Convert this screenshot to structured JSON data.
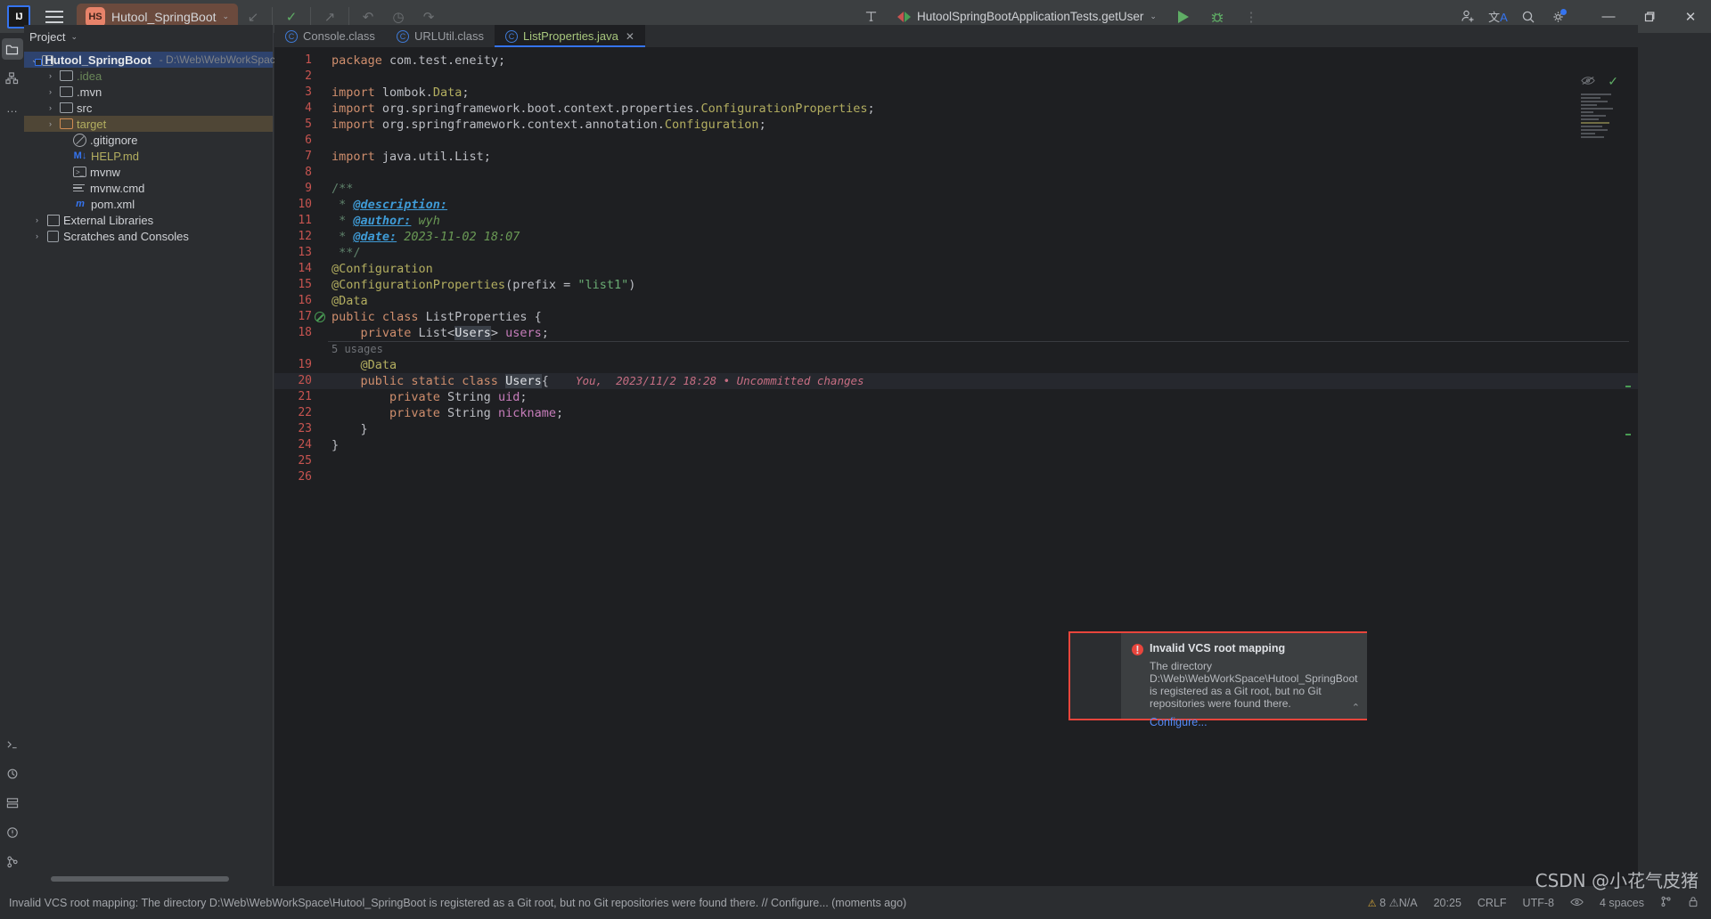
{
  "titlebar": {
    "ij_logo": "IJ",
    "menu_icon": "hamburger-menu-icon",
    "project_badge": "HS",
    "project_name": "Hutool_SpringBoot",
    "chevron": "⌄",
    "buttons": [
      {
        "name": "update-project-button",
        "glyph": "↙",
        "style": "dim"
      },
      {
        "name": "commit-button",
        "glyph": "✓",
        "style": "green"
      },
      {
        "name": "push-button",
        "glyph": "↗",
        "style": "dim"
      },
      {
        "name": "undo-button",
        "glyph": "↶",
        "style": "dim"
      },
      {
        "name": "history-button",
        "glyph": "◷",
        "style": "dim"
      },
      {
        "name": "redo-button",
        "glyph": "↷",
        "style": "dim"
      }
    ],
    "build_icon": "hammer-icon",
    "run_config": "HutoolSpringBootApplicationTests.getUser",
    "run_button": "run-icon",
    "debug_button": "debug-icon",
    "more_button": "⋮",
    "right_icons": [
      {
        "name": "add-user-icon",
        "glyph": "⚇"
      },
      {
        "name": "translate-icon",
        "glyph": "文"
      },
      {
        "name": "search-icon",
        "glyph": "⌕"
      },
      {
        "name": "settings-gear-icon",
        "glyph": "⚙"
      }
    ],
    "window_controls": {
      "minimize": "—",
      "maximize": "❐",
      "close": "✕"
    }
  },
  "rail": {
    "top": [
      {
        "name": "project-tool-icon",
        "glyph": "▢",
        "active": true
      },
      {
        "name": "structure-tool-icon",
        "glyph": "⛓"
      },
      {
        "name": "more-tool-icon",
        "glyph": "…"
      }
    ],
    "bottom": [
      {
        "name": "terminal-tool-icon",
        "glyph": "⎇"
      },
      {
        "name": "build-tool-icon",
        "glyph": "⚒"
      },
      {
        "name": "services-tool-icon",
        "glyph": "⊙"
      },
      {
        "name": "problems-tool-icon",
        "glyph": "ⓘ"
      },
      {
        "name": "version-control-tool-icon",
        "glyph": "⎇"
      }
    ]
  },
  "project": {
    "title": "Project",
    "chevron": "⌄",
    "tree": [
      {
        "indent": 0,
        "arrow": "⌄",
        "icon": "module-icon",
        "label": "Hutool_SpringBoot",
        "bold": true,
        "path": "- D:\\Web\\WebWorkSpace\\H",
        "selected": "blue"
      },
      {
        "indent": 1,
        "arrow": "›",
        "icon": "folder-icon",
        "label": ".idea",
        "color": "green"
      },
      {
        "indent": 1,
        "arrow": "›",
        "icon": "folder-icon",
        "label": ".mvn"
      },
      {
        "indent": 1,
        "arrow": "›",
        "icon": "folder-icon",
        "label": "src"
      },
      {
        "indent": 1,
        "arrow": "›",
        "icon": "folder-orange-icon",
        "label": "target",
        "color": "yellow",
        "selected": "brown"
      },
      {
        "indent": 2,
        "arrow": "",
        "icon": "gitignore-icon",
        "label": ".gitignore"
      },
      {
        "indent": 2,
        "arrow": "",
        "icon": "markdown-icon",
        "label": "HELP.md",
        "color": "yellow"
      },
      {
        "indent": 2,
        "arrow": "",
        "icon": "shell-script-icon",
        "label": "mvnw"
      },
      {
        "indent": 2,
        "arrow": "",
        "icon": "cmd-file-icon",
        "label": "mvnw.cmd"
      },
      {
        "indent": 2,
        "arrow": "",
        "icon": "maven-pom-icon",
        "label": "pom.xml"
      },
      {
        "indent": 0,
        "arrow": "›",
        "icon": "external-libraries-icon",
        "label": "External Libraries"
      },
      {
        "indent": 0,
        "arrow": "›",
        "icon": "scratches-icon",
        "label": "Scratches and Consoles"
      }
    ]
  },
  "editor": {
    "tabs": [
      {
        "label": "Console.class",
        "icon": "class-file-icon",
        "active": false,
        "closable": false
      },
      {
        "label": "URLUtil.class",
        "icon": "class-file-icon",
        "active": false,
        "closable": false
      },
      {
        "label": "ListProperties.java",
        "icon": "java-class-icon",
        "active": true,
        "closable": true,
        "close_glyph": "✕"
      }
    ],
    "inline_hints": {
      "usages": "5 usages",
      "vcs_annotation": "You,  2023/11/2 18:28 • Uncommitted changes"
    },
    "inspection": {
      "eye_icon": "preview-eye-icon",
      "ok_icon": "✓"
    },
    "lines": [
      {
        "n": "1",
        "tokens": [
          {
            "t": "package ",
            "c": "kw"
          },
          {
            "t": "com.test.eneity;",
            "c": "plain"
          }
        ]
      },
      {
        "n": "2",
        "tokens": []
      },
      {
        "n": "3",
        "tokens": [
          {
            "t": "import ",
            "c": "kw"
          },
          {
            "t": "lombok.",
            "c": "plain"
          },
          {
            "t": "Data",
            "c": "ann"
          },
          {
            "t": ";",
            "c": "plain"
          }
        ]
      },
      {
        "n": "4",
        "tokens": [
          {
            "t": "import ",
            "c": "kw"
          },
          {
            "t": "org.springframework.boot.context.properties.",
            "c": "plain"
          },
          {
            "t": "ConfigurationProperties",
            "c": "ann"
          },
          {
            "t": ";",
            "c": "plain"
          }
        ]
      },
      {
        "n": "5",
        "tokens": [
          {
            "t": "import ",
            "c": "kw"
          },
          {
            "t": "org.springframework.context.annotation.",
            "c": "plain"
          },
          {
            "t": "Configuration",
            "c": "ann"
          },
          {
            "t": ";",
            "c": "plain"
          }
        ]
      },
      {
        "n": "6",
        "tokens": []
      },
      {
        "n": "7",
        "tokens": [
          {
            "t": "import ",
            "c": "kw"
          },
          {
            "t": "java.util.List;",
            "c": "plain"
          }
        ]
      },
      {
        "n": "8",
        "tokens": []
      },
      {
        "n": "9",
        "tokens": [
          {
            "t": "/**",
            "c": "doc"
          }
        ]
      },
      {
        "n": "10",
        "tokens": [
          {
            "t": " * ",
            "c": "doc"
          },
          {
            "t": "@description:",
            "c": "doctag"
          }
        ]
      },
      {
        "n": "11",
        "tokens": [
          {
            "t": " * ",
            "c": "doc"
          },
          {
            "t": "@author:",
            "c": "doctag"
          },
          {
            "t": " wyh",
            "c": "docval"
          }
        ]
      },
      {
        "n": "12",
        "tokens": [
          {
            "t": " * ",
            "c": "doc"
          },
          {
            "t": "@date:",
            "c": "doctag"
          },
          {
            "t": " 2023-11-02 18:07",
            "c": "docval"
          }
        ]
      },
      {
        "n": "13",
        "tokens": [
          {
            "t": " **/",
            "c": "doc"
          }
        ]
      },
      {
        "n": "14",
        "tokens": [
          {
            "t": "@Configuration",
            "c": "ann"
          }
        ]
      },
      {
        "n": "15",
        "tokens": [
          {
            "t": "@ConfigurationProperties",
            "c": "ann"
          },
          {
            "t": "(prefix = ",
            "c": "plain"
          },
          {
            "t": "\"list1\"",
            "c": "str"
          },
          {
            "t": ")",
            "c": "plain"
          }
        ]
      },
      {
        "n": "16",
        "tokens": [
          {
            "t": "@Data",
            "c": "ann"
          }
        ]
      },
      {
        "n": "17",
        "gutter": "suppress-inspection-icon",
        "tokens": [
          {
            "t": "public class ",
            "c": "kw"
          },
          {
            "t": "ListProperties",
            "c": "plain"
          },
          {
            "t": " {",
            "c": "plain"
          }
        ]
      },
      {
        "n": "18",
        "tokens": [
          {
            "t": "    private ",
            "c": "kw"
          },
          {
            "t": "List<",
            "c": "plain"
          },
          {
            "t": "Users",
            "c": "hl"
          },
          {
            "t": "> ",
            "c": "plain"
          },
          {
            "t": "users",
            "c": "field"
          },
          {
            "t": ";",
            "c": "plain"
          }
        ]
      },
      {
        "n": "",
        "hint": "5 usages",
        "separator": true,
        "tokens": []
      },
      {
        "n": "19",
        "tokens": [
          {
            "t": "    @Data",
            "c": "ann"
          }
        ]
      },
      {
        "n": "20",
        "current": true,
        "annotation": "You,  2023/11/2 18:28 • Uncommitted changes",
        "tokens": [
          {
            "t": "    public static class ",
            "c": "kw"
          },
          {
            "t": "Users",
            "c": "hl"
          },
          {
            "t": "{",
            "c": "plain"
          }
        ]
      },
      {
        "n": "21",
        "tokens": [
          {
            "t": "        private ",
            "c": "kw"
          },
          {
            "t": "String ",
            "c": "plain"
          },
          {
            "t": "uid",
            "c": "field"
          },
          {
            "t": ";",
            "c": "plain"
          }
        ]
      },
      {
        "n": "22",
        "tokens": [
          {
            "t": "        private ",
            "c": "kw"
          },
          {
            "t": "String ",
            "c": "plain"
          },
          {
            "t": "nickname",
            "c": "field"
          },
          {
            "t": ";",
            "c": "plain"
          }
        ]
      },
      {
        "n": "23",
        "tokens": [
          {
            "t": "    }",
            "c": "plain"
          }
        ]
      },
      {
        "n": "24",
        "tokens": [
          {
            "t": "}",
            "c": "plain"
          }
        ]
      },
      {
        "n": "25",
        "tokens": []
      },
      {
        "n": "26",
        "tokens": []
      }
    ]
  },
  "notification": {
    "error_glyph": "!",
    "title": "Invalid VCS root mapping",
    "body": "The directory D:\\Web\\WebWorkSpace\\Hutool_SpringBoot is registered as a Git root, but no Git repositories were found there.",
    "link": "Configure...",
    "collapse_glyph": "⌃"
  },
  "status": {
    "message": "Invalid VCS root mapping: The directory D:\\Web\\WebWorkSpace\\Hutool_SpringBoot is registered as a Git root, but no Git repositories were found there. // Configure... (moments ago)",
    "warn_glyph": "⚠",
    "problems": "8 ⚠N/A",
    "caret": "20:25",
    "line_sep": "CRLF",
    "encoding": "UTF-8",
    "eye_icon": "reader-mode-icon",
    "indent": "4 spaces",
    "branch_icon": "branch-icon",
    "lock_icon": "lock-icon"
  },
  "watermark": "CSDN @小花气皮猪",
  "colors": {
    "accent": "#3574f0",
    "error": "#e8453c",
    "keyword": "#cf8e6d",
    "annotation": "#b3ae60",
    "string": "#6aab73",
    "editor_bg": "#1e1f22",
    "chrome_bg": "#2b2d30"
  }
}
